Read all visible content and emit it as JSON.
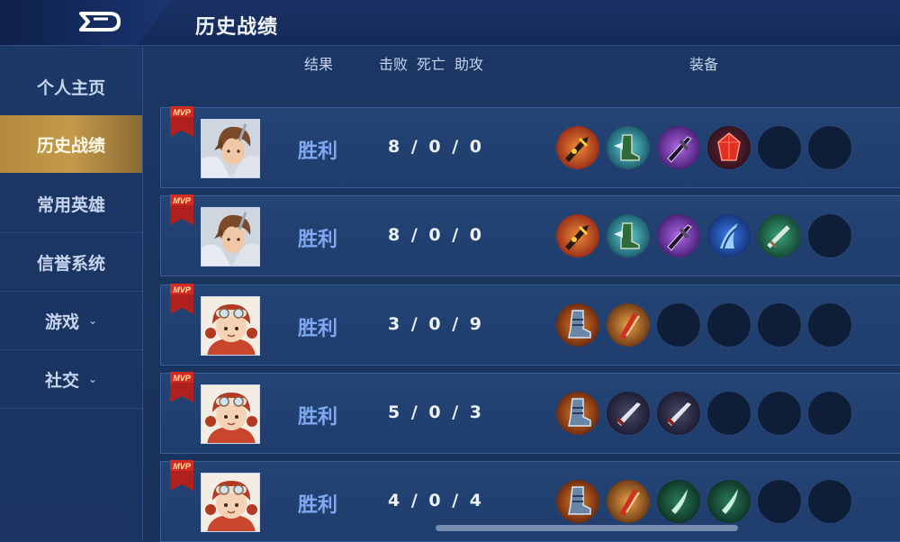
{
  "header": {
    "title": "历史战绩"
  },
  "sidebar": {
    "items": [
      {
        "label": "个人主页"
      },
      {
        "label": "历史战绩"
      },
      {
        "label": "常用英雄"
      },
      {
        "label": "信誉系统"
      },
      {
        "label": "游戏",
        "chev": "⌄"
      },
      {
        "label": "社交",
        "chev": "⌄"
      }
    ]
  },
  "columns": {
    "result": "结果",
    "kills": "击败",
    "deaths": "死亡",
    "assists": "助攻",
    "equipment": "装备"
  },
  "matches": [
    {
      "badge": "MVP",
      "hero": "swordsman",
      "result": "胜利",
      "kda": "8 / 0 / 0",
      "items": [
        "flame-blade",
        "winged-boots",
        "purple-blade",
        "red-crystal",
        "empty",
        "empty"
      ]
    },
    {
      "badge": "MVP",
      "hero": "swordsman",
      "result": "胜利",
      "kda": "8 / 0 / 0",
      "items": [
        "flame-blade",
        "winged-boots",
        "purple-blade",
        "blue-claw",
        "green-sword",
        "empty"
      ]
    },
    {
      "badge": "MVP",
      "hero": "girl-goggles",
      "result": "胜利",
      "kda": "3 / 0 / 9",
      "items": [
        "armor-boots",
        "red-claw",
        "empty",
        "empty",
        "empty",
        "empty"
      ]
    },
    {
      "badge": "MVP",
      "hero": "girl-goggles",
      "result": "胜利",
      "kda": "5 / 0 / 3",
      "items": [
        "armor-boots",
        "dagger",
        "dagger",
        "empty",
        "empty",
        "empty"
      ]
    },
    {
      "badge": "MVP",
      "hero": "girl-goggles",
      "result": "胜利",
      "kda": "4 / 0 / 4",
      "items": [
        "armor-boots",
        "red-claw",
        "green-dagger",
        "green-dagger",
        "empty",
        "empty"
      ]
    }
  ]
}
